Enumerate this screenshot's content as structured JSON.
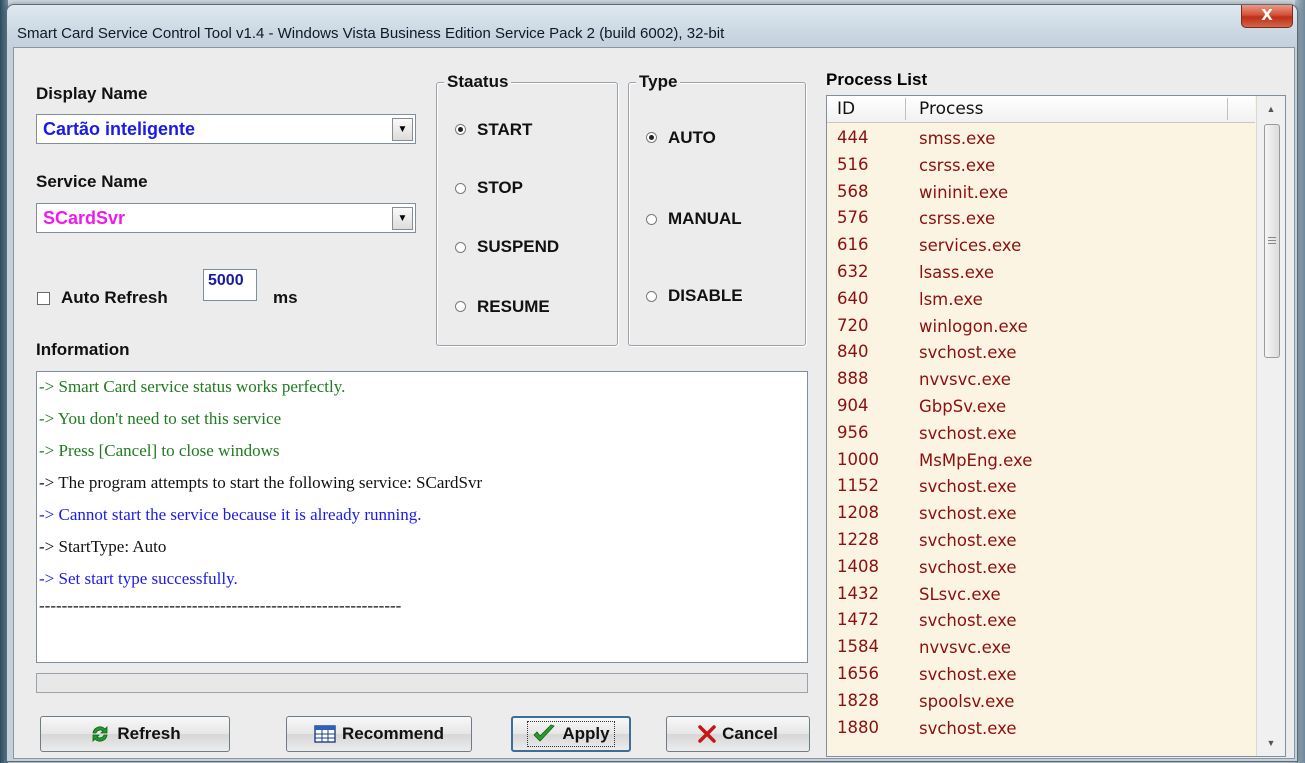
{
  "window": {
    "title": "Smart Card Service Control Tool v1.4 - Windows Vista Business Edition Service Pack 2 (build 6002), 32-bit",
    "close_label": "X"
  },
  "display_name": {
    "label": "Display Name",
    "value": "Cartão inteligente",
    "color": "#1a1aee"
  },
  "service_name": {
    "label": "Service Name",
    "value": "SCardSvr",
    "color": "#ee1aee"
  },
  "auto_refresh": {
    "label": "Auto Refresh",
    "checked": false,
    "interval": "5000",
    "unit": "ms"
  },
  "status_group": {
    "title": "Staatus",
    "options": [
      "START",
      "STOP",
      "SUSPEND",
      "RESUME"
    ],
    "selected": "START"
  },
  "type_group": {
    "title": "Type",
    "options": [
      "AUTO",
      "MANUAL",
      "DISABLE"
    ],
    "selected": "AUTO"
  },
  "information": {
    "label": "Information",
    "lines": [
      {
        "text": "-> Smart Card service status works perfectly.",
        "color": "#1f7a1f"
      },
      {
        "text": "-> You don't need to set this service",
        "color": "#1f7a1f"
      },
      {
        "text": "-> Press [Cancel] to close windows",
        "color": "#1f7a1f"
      },
      {
        "text": "-> The program attempts to start the following service: SCardSvr",
        "color": "#111111"
      },
      {
        "text": "-> Cannot start the service because it is already running.",
        "color": "#1a1aee"
      },
      {
        "text": "-> StartType: Auto",
        "color": "#111111"
      },
      {
        "text": "-> Set start type successfully.",
        "color": "#1a1aee"
      },
      {
        "text": "----------------------------------------------------------------",
        "color": "#111111"
      }
    ]
  },
  "buttons": {
    "refresh": "Refresh",
    "recommend": "Recommend",
    "apply": "Apply",
    "cancel": "Cancel"
  },
  "process_list": {
    "title": "Process List",
    "columns": [
      "ID",
      "Process"
    ],
    "rows": [
      [
        "444",
        "smss.exe"
      ],
      [
        "516",
        "csrss.exe"
      ],
      [
        "568",
        "wininit.exe"
      ],
      [
        "576",
        "csrss.exe"
      ],
      [
        "616",
        "services.exe"
      ],
      [
        "632",
        "lsass.exe"
      ],
      [
        "640",
        "lsm.exe"
      ],
      [
        "720",
        "winlogon.exe"
      ],
      [
        "840",
        "svchost.exe"
      ],
      [
        "888",
        "nvvsvc.exe"
      ],
      [
        "904",
        "GbpSv.exe"
      ],
      [
        "956",
        "svchost.exe"
      ],
      [
        "1000",
        "MsMpEng.exe"
      ],
      [
        "1152",
        "svchost.exe"
      ],
      [
        "1208",
        "svchost.exe"
      ],
      [
        "1228",
        "svchost.exe"
      ],
      [
        "1408",
        "svchost.exe"
      ],
      [
        "1432",
        "SLsvc.exe"
      ],
      [
        "1472",
        "svchost.exe"
      ],
      [
        "1584",
        "nvvsvc.exe"
      ],
      [
        "1656",
        "svchost.exe"
      ],
      [
        "1828",
        "spoolsv.exe"
      ],
      [
        "1880",
        "svchost.exe"
      ]
    ]
  }
}
